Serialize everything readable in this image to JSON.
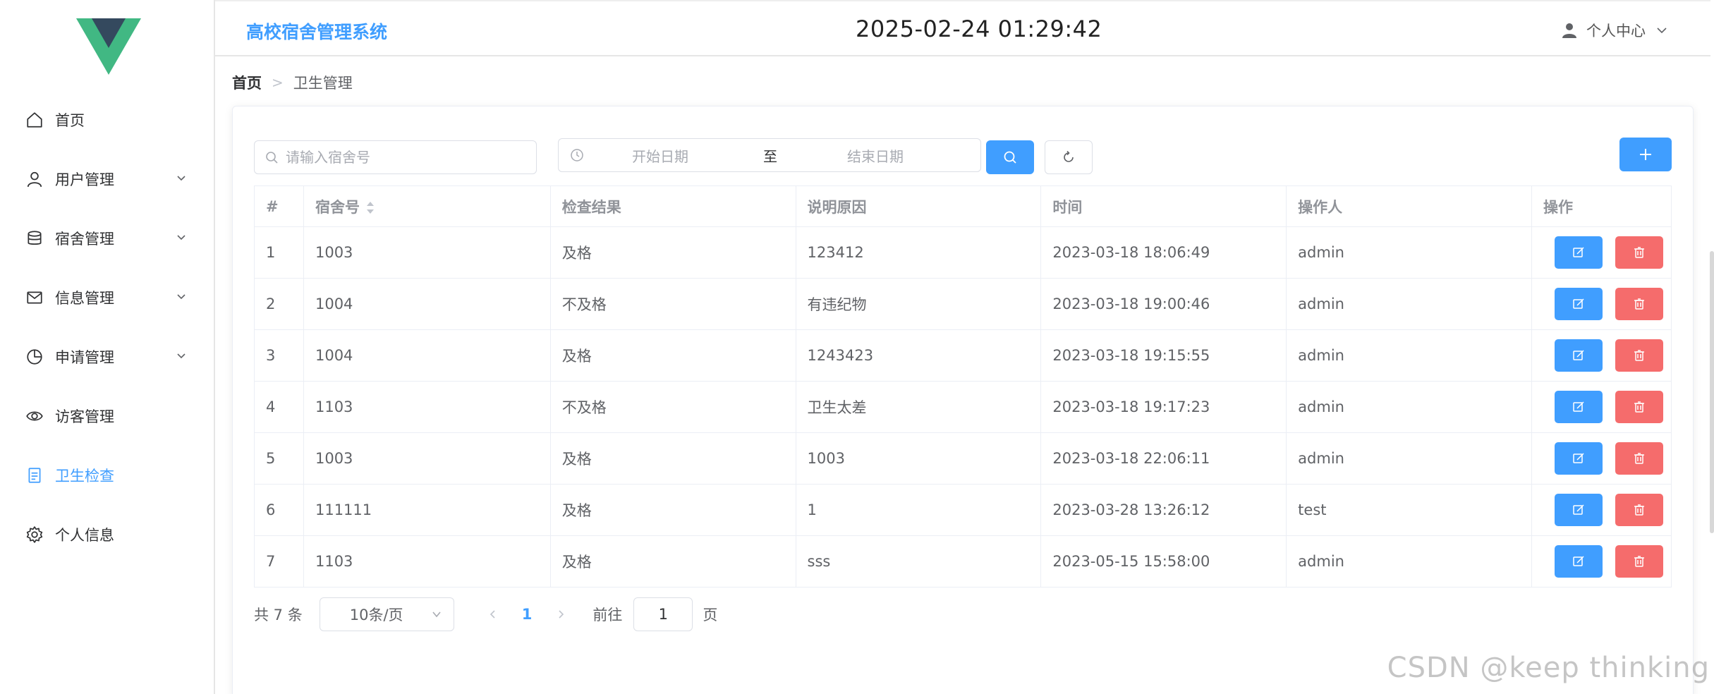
{
  "header": {
    "system_title": "高校宿舍管理系统",
    "clock": "2025-02-24 01:29:42",
    "user_center": "个人中心"
  },
  "sidebar": {
    "items": [
      {
        "label": "首页",
        "icon": "home-icon",
        "has_arrow": false,
        "active": false
      },
      {
        "label": "用户管理",
        "icon": "user-icon",
        "has_arrow": true,
        "active": false
      },
      {
        "label": "宿舍管理",
        "icon": "database-icon",
        "has_arrow": true,
        "active": false
      },
      {
        "label": "信息管理",
        "icon": "message-icon",
        "has_arrow": true,
        "active": false
      },
      {
        "label": "申请管理",
        "icon": "pie-chart-icon",
        "has_arrow": true,
        "active": false
      },
      {
        "label": "访客管理",
        "icon": "eye-icon",
        "has_arrow": false,
        "active": false
      },
      {
        "label": "卫生检查",
        "icon": "document-icon",
        "has_arrow": false,
        "active": true
      },
      {
        "label": "个人信息",
        "icon": "gear-icon",
        "has_arrow": false,
        "active": false
      }
    ]
  },
  "breadcrumb": {
    "home": "首页",
    "separator": ">",
    "current": "卫生管理"
  },
  "toolbar": {
    "search_placeholder": "请输入宿舍号",
    "date_start_placeholder": "开始日期",
    "date_separator": "至",
    "date_end_placeholder": "结束日期"
  },
  "table": {
    "columns": [
      "#",
      "宿舍号",
      "检查结果",
      "说明原因",
      "时间",
      "操作人",
      "操作"
    ],
    "rows": [
      [
        "1",
        "1003",
        "及格",
        "123412",
        "2023-03-18 18:06:49",
        "admin"
      ],
      [
        "2",
        "1004",
        "不及格",
        "有违纪物",
        "2023-03-18 19:00:46",
        "admin"
      ],
      [
        "3",
        "1004",
        "及格",
        "1243423",
        "2023-03-18 19:15:55",
        "admin"
      ],
      [
        "4",
        "1103",
        "不及格",
        "卫生太差",
        "2023-03-18 19:17:23",
        "admin"
      ],
      [
        "5",
        "1003",
        "及格",
        "1003",
        "2023-03-18 22:06:11",
        "admin"
      ],
      [
        "6",
        "111111",
        "及格",
        "1",
        "2023-03-28 13:26:12",
        "test"
      ],
      [
        "7",
        "1103",
        "及格",
        "sss",
        "2023-05-15 15:58:00",
        "admin"
      ]
    ]
  },
  "pagination": {
    "total": "共 7 条",
    "page_size": "10条/页",
    "current_page": "1",
    "goto_label": "前往",
    "goto_value": "1",
    "goto_unit": "页"
  },
  "watermark": "CSDN @keep   thinking",
  "colors": {
    "primary": "#409eff",
    "danger": "#f56c6c",
    "logo_green": "#41b883",
    "logo_dark": "#34495e"
  }
}
